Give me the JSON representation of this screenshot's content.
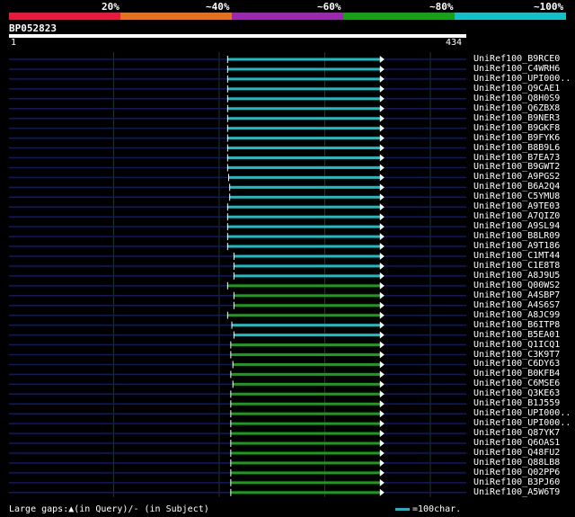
{
  "header": {
    "pct_labels": [
      "20%",
      "~40%",
      "~60%",
      "~80%",
      "~100%"
    ],
    "colors": [
      "#e8193c",
      "#e6711c",
      "#9c27b0",
      "#16a016",
      "#14c0c8"
    ],
    "query_name": "BP052823",
    "tick_start": "1",
    "tick_end": "434"
  },
  "chart_data": {
    "type": "alignment",
    "query_length": 434,
    "x_range": [
      1,
      434
    ],
    "grid_positions": [
      100,
      200,
      300,
      400
    ],
    "hits": [
      {
        "name": "UniRef100_B9RCE0",
        "start": 208,
        "end": 353,
        "color": "#14c0c8"
      },
      {
        "name": "UniRef100_C4WRH6",
        "start": 208,
        "end": 353,
        "color": "#14c0c8"
      },
      {
        "name": "UniRef100_UPI000..",
        "start": 208,
        "end": 353,
        "color": "#14c0c8"
      },
      {
        "name": "UniRef100_Q9CAE1",
        "start": 208,
        "end": 353,
        "color": "#14c0c8"
      },
      {
        "name": "UniRef100_Q8H0S9",
        "start": 208,
        "end": 353,
        "color": "#14c0c8"
      },
      {
        "name": "UniRef100_Q6ZBX8",
        "start": 208,
        "end": 353,
        "color": "#14c0c8"
      },
      {
        "name": "UniRef100_B9NER3",
        "start": 208,
        "end": 353,
        "color": "#14c0c8"
      },
      {
        "name": "UniRef100_B9GKF8",
        "start": 208,
        "end": 353,
        "color": "#14c0c8"
      },
      {
        "name": "UniRef100_B9FYK6",
        "start": 208,
        "end": 353,
        "color": "#14c0c8"
      },
      {
        "name": "UniRef100_B8B9L6",
        "start": 208,
        "end": 353,
        "color": "#14c0c8"
      },
      {
        "name": "UniRef100_B7EA73",
        "start": 208,
        "end": 353,
        "color": "#14c0c8"
      },
      {
        "name": "UniRef100_B9GWT2",
        "start": 208,
        "end": 353,
        "color": "#14c0c8"
      },
      {
        "name": "UniRef100_A9PGS2",
        "start": 209,
        "end": 353,
        "color": "#14c0c8"
      },
      {
        "name": "UniRef100_B6A2Q4",
        "start": 210,
        "end": 353,
        "color": "#14c0c8"
      },
      {
        "name": "UniRef100_C5YMU8",
        "start": 210,
        "end": 353,
        "color": "#14c0c8"
      },
      {
        "name": "UniRef100_A9TE03",
        "start": 208,
        "end": 353,
        "color": "#14c0c8"
      },
      {
        "name": "UniRef100_A7QIZ0",
        "start": 208,
        "end": 353,
        "color": "#14c0c8"
      },
      {
        "name": "UniRef100_A9SL94",
        "start": 208,
        "end": 353,
        "color": "#14c0c8"
      },
      {
        "name": "UniRef100_B8LR09",
        "start": 208,
        "end": 353,
        "color": "#14c0c8"
      },
      {
        "name": "UniRef100_A9T186",
        "start": 208,
        "end": 353,
        "color": "#14c0c8"
      },
      {
        "name": "UniRef100_C1MT44",
        "start": 214,
        "end": 353,
        "color": "#14c0c8"
      },
      {
        "name": "UniRef100_C1E8T8",
        "start": 214,
        "end": 353,
        "color": "#14c0c8"
      },
      {
        "name": "UniRef100_A8J9U5",
        "start": 214,
        "end": 353,
        "color": "#14c0c8"
      },
      {
        "name": "UniRef100_Q00WS2",
        "start": 208,
        "end": 353,
        "color": "#16a016"
      },
      {
        "name": "UniRef100_A4SBP7",
        "start": 214,
        "end": 353,
        "color": "#16a016"
      },
      {
        "name": "UniRef100_A4S6S7",
        "start": 214,
        "end": 353,
        "color": "#16a016"
      },
      {
        "name": "UniRef100_A8JC99",
        "start": 208,
        "end": 353,
        "color": "#16a016"
      },
      {
        "name": "UniRef100_B6ITP8",
        "start": 212,
        "end": 353,
        "color": "#14c0c8"
      },
      {
        "name": "UniRef100_B5EA01",
        "start": 214,
        "end": 353,
        "color": "#14c0c8"
      },
      {
        "name": "UniRef100_Q1ICQ1",
        "start": 211,
        "end": 353,
        "color": "#16a016"
      },
      {
        "name": "UniRef100_C3K9T7",
        "start": 211,
        "end": 353,
        "color": "#16a016"
      },
      {
        "name": "UniRef100_C6DY63",
        "start": 213,
        "end": 353,
        "color": "#16a016"
      },
      {
        "name": "UniRef100_B0KFB4",
        "start": 211,
        "end": 353,
        "color": "#16a016"
      },
      {
        "name": "UniRef100_C6MSE6",
        "start": 213,
        "end": 353,
        "color": "#16a016"
      },
      {
        "name": "UniRef100_Q3KE63",
        "start": 211,
        "end": 353,
        "color": "#16a016"
      },
      {
        "name": "UniRef100_B1J559",
        "start": 211,
        "end": 353,
        "color": "#16a016"
      },
      {
        "name": "UniRef100_UPI000..",
        "start": 211,
        "end": 353,
        "color": "#16a016"
      },
      {
        "name": "UniRef100_UPI000..",
        "start": 211,
        "end": 353,
        "color": "#16a016"
      },
      {
        "name": "UniRef100_Q87YK7",
        "start": 211,
        "end": 353,
        "color": "#16a016"
      },
      {
        "name": "UniRef100_Q6OAS1",
        "start": 211,
        "end": 353,
        "color": "#16a016"
      },
      {
        "name": "UniRef100_Q48FU2",
        "start": 211,
        "end": 353,
        "color": "#16a016"
      },
      {
        "name": "UniRef100_Q88LB8",
        "start": 211,
        "end": 353,
        "color": "#16a016"
      },
      {
        "name": "UniRef100_Q02PP6",
        "start": 211,
        "end": 353,
        "color": "#16a016"
      },
      {
        "name": "UniRef100_B3PJ60",
        "start": 211,
        "end": 353,
        "color": "#16a016"
      },
      {
        "name": "UniRef100_A5W6T9",
        "start": 211,
        "end": 353,
        "color": "#16a016"
      }
    ]
  },
  "footer": {
    "gaps_note": "Large gaps:▲(in Query)/- (in Subject)",
    "scale_note": "=100char."
  }
}
